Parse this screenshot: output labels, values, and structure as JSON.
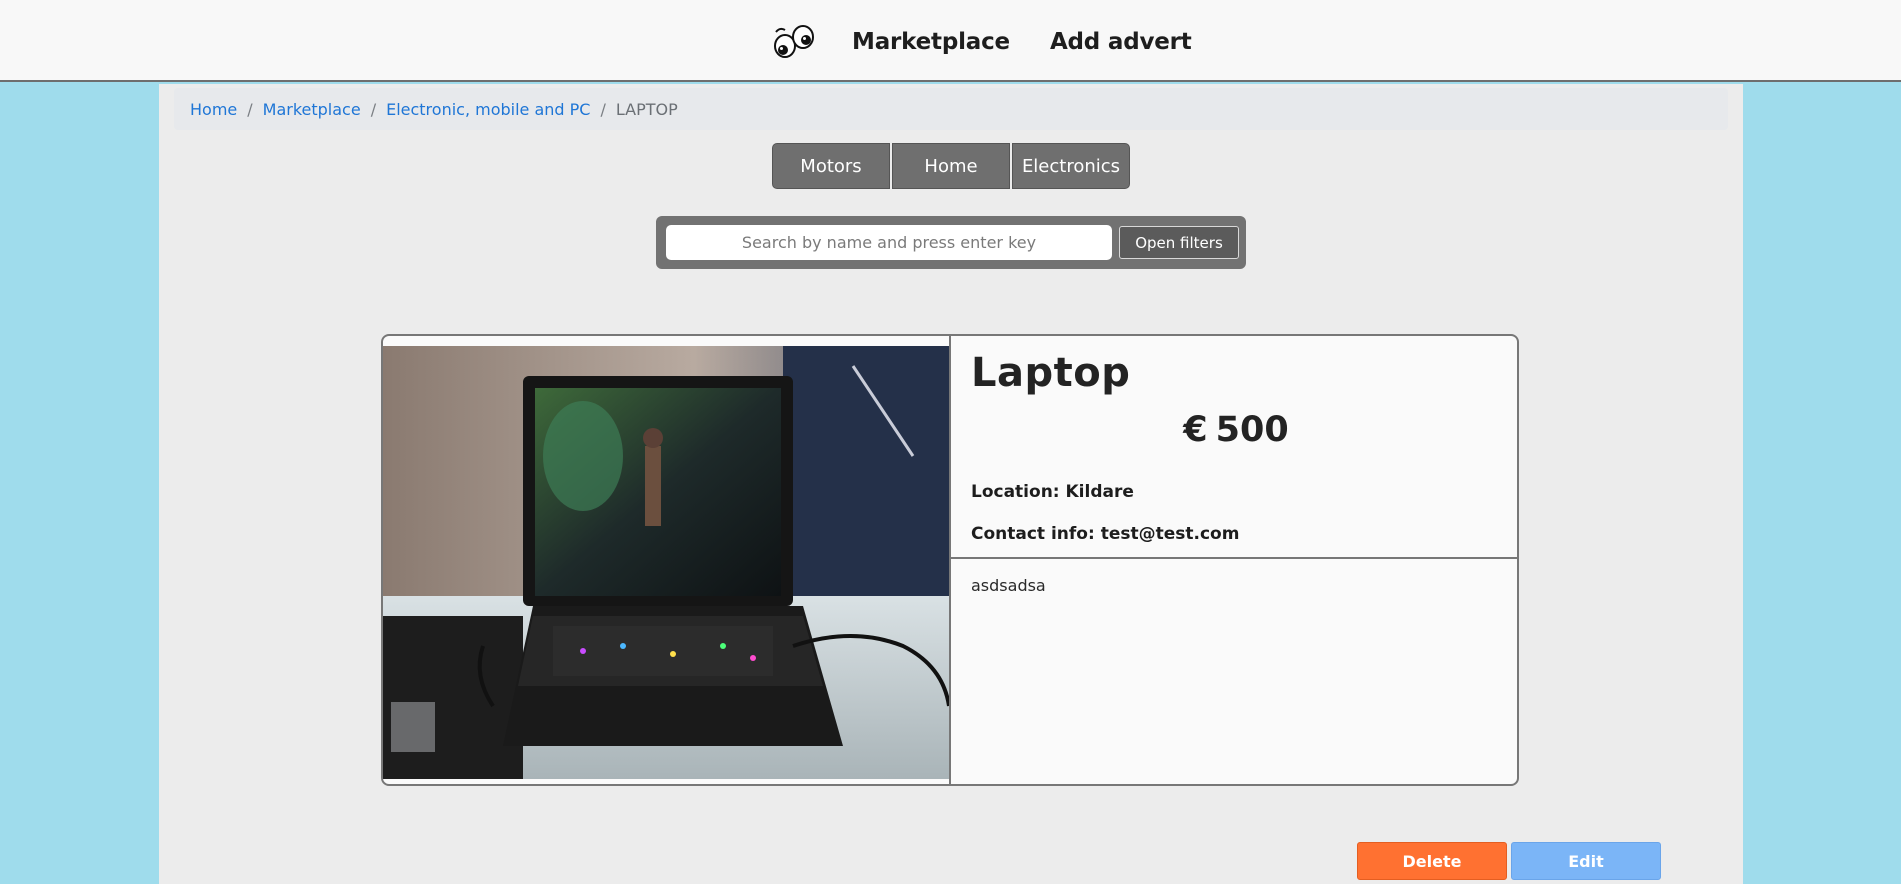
{
  "header": {
    "logo_icon": "googly-eyes-logo-icon",
    "nav": [
      {
        "label": "Marketplace"
      },
      {
        "label": "Add advert"
      }
    ]
  },
  "breadcrumb": {
    "items": [
      {
        "label": "Home"
      },
      {
        "label": "Marketplace"
      },
      {
        "label": "Electronic, mobile and PC"
      }
    ],
    "current": "LAPTOP",
    "separator": "/"
  },
  "categories": [
    {
      "label": "Motors"
    },
    {
      "label": "Home"
    },
    {
      "label": "Electronics"
    }
  ],
  "search": {
    "placeholder": "Search by name and press enter key",
    "value": "",
    "filters_button": "Open filters"
  },
  "advert": {
    "title": "Laptop",
    "currency": "€",
    "price": "500",
    "location": "Location: Kildare",
    "contact": "Contact info: test@test.com",
    "description": "asdsadsa",
    "image_icon": "laptop-photo"
  },
  "actions": {
    "delete_label": "Delete",
    "edit_label": "Edit"
  },
  "colors": {
    "page_background": "#9fdcec",
    "content_background": "#ececec",
    "link": "#1f76d6",
    "category_button": "#6f6f6f",
    "delete": "#ff7131",
    "edit": "#7bb5f7"
  }
}
